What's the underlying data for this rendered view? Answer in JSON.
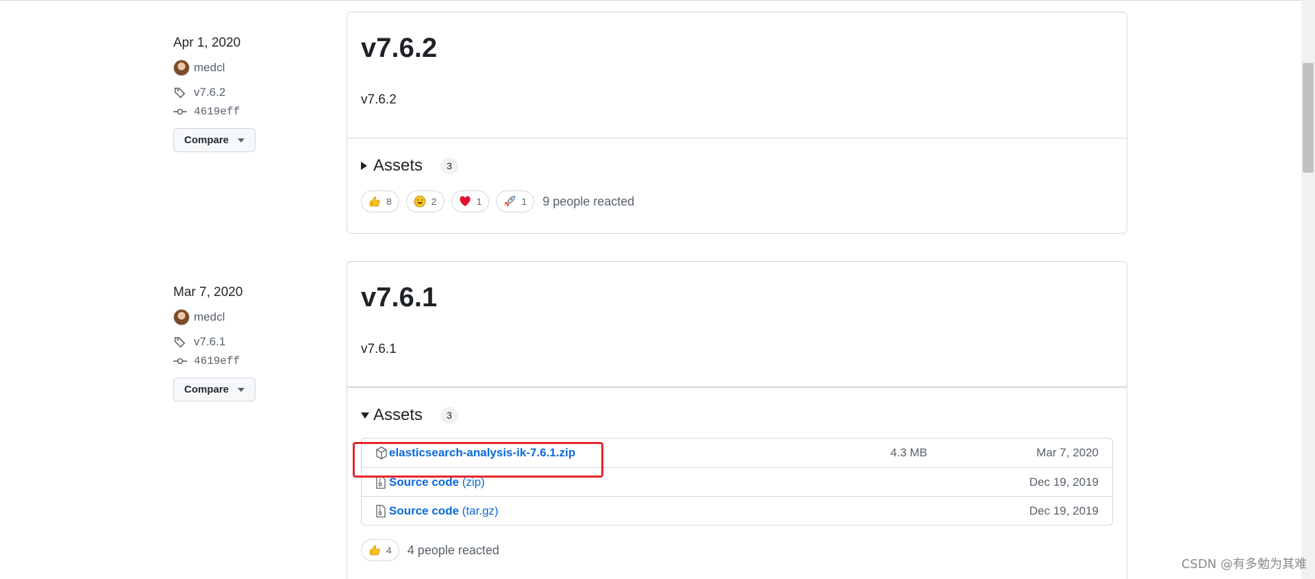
{
  "colors": {
    "link": "#0969da",
    "border": "#d0d7de",
    "highlight": "#e5252a"
  },
  "releases": [
    {
      "date": "Apr 1, 2020",
      "author": "medcl",
      "tag": "v7.6.2",
      "commit": "4619eff",
      "compare_label": "Compare",
      "title": "v7.6.2",
      "description": "v7.6.2",
      "assets_label": "Assets",
      "assets_count": "3",
      "assets_expanded": false,
      "reactions": [
        {
          "icon": "thumbs-up-icon",
          "count": "8"
        },
        {
          "icon": "smile-icon",
          "count": "2"
        },
        {
          "icon": "heart-icon",
          "count": "1"
        },
        {
          "icon": "rocket-icon",
          "count": "1"
        }
      ],
      "reacted_text": "9 people reacted"
    },
    {
      "date": "Mar 7, 2020",
      "author": "medcl",
      "tag": "v7.6.1",
      "commit": "4619eff",
      "compare_label": "Compare",
      "title": "v7.6.1",
      "description": "v7.6.1",
      "assets_label": "Assets",
      "assets_count": "3",
      "assets_expanded": true,
      "assets": [
        {
          "icon": "package-icon",
          "name": "elasticsearch-analysis-ik-7.6.1.zip",
          "suffix": "",
          "size": "4.3 MB",
          "date": "Mar 7, 2020"
        },
        {
          "icon": "file-zip-icon",
          "name": "Source code",
          "suffix": "(zip)",
          "size": "",
          "date": "Dec 19, 2019"
        },
        {
          "icon": "file-zip-icon",
          "name": "Source code",
          "suffix": "(tar.gz)",
          "size": "",
          "date": "Dec 19, 2019"
        }
      ],
      "reactions": [
        {
          "icon": "thumbs-up-icon",
          "count": "4"
        }
      ],
      "reacted_text": "4 people reacted"
    }
  ],
  "watermark": "CSDN @有多勉为其难"
}
